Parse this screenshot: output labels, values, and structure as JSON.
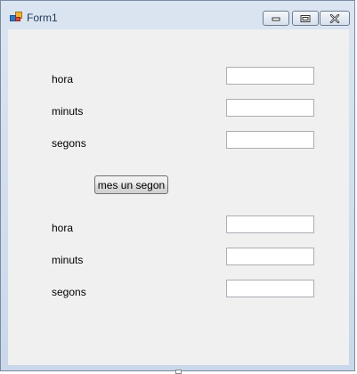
{
  "window": {
    "title": "Form1",
    "app_icon": "form-app-icon",
    "controls": {
      "minimize": "minimize-icon",
      "maximize": "maximize-icon",
      "close": "close-icon"
    }
  },
  "form": {
    "group1": {
      "hora_label": "hora",
      "minuts_label": "minuts",
      "segons_label": "segons",
      "hora_value": "",
      "minuts_value": "",
      "segons_value": ""
    },
    "button_label": "mes un segon",
    "group2": {
      "hora_label": "hora",
      "minuts_label": "minuts",
      "segons_label": "segons",
      "hora_value": "",
      "minuts_value": "",
      "segons_value": ""
    }
  },
  "colors": {
    "title_text": "#1e395b",
    "client_background": "#f0f0f0",
    "frame": "#c9d8ea"
  }
}
